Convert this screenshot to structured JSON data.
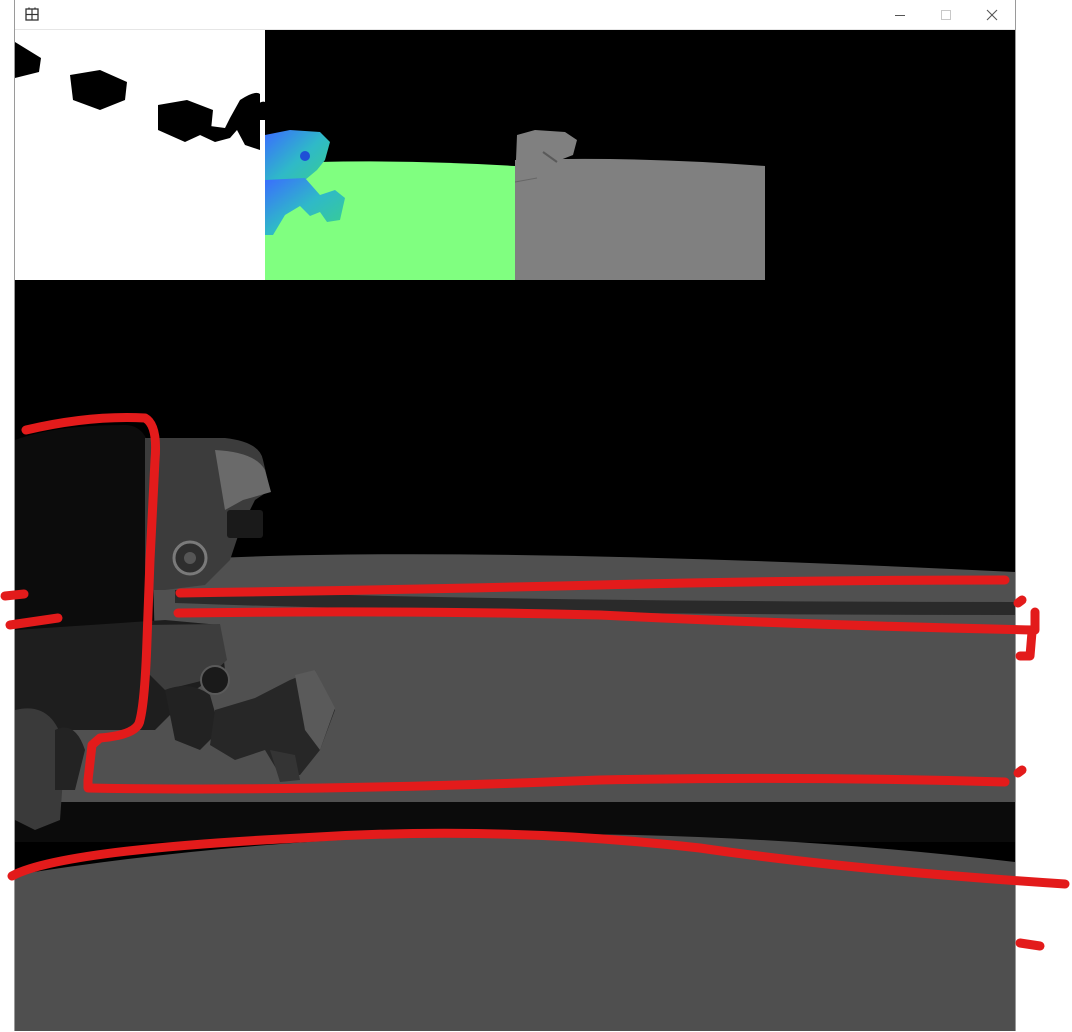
{
  "window": {
    "title": "",
    "icon": "app-grid-icon",
    "controls": [
      "minimize-icon",
      "maximize-icon",
      "close-icon"
    ]
  },
  "viewport": {
    "panels": [
      "shadow-map",
      "normal-buffer",
      "depth-buffer"
    ],
    "scene": "robot-on-ground-3d-render"
  },
  "colors": {
    "background": "#000000",
    "ground": "#505050",
    "normal_green": "#80ff80",
    "depth_gray": "#808080",
    "annotation": "#e31b1b"
  }
}
